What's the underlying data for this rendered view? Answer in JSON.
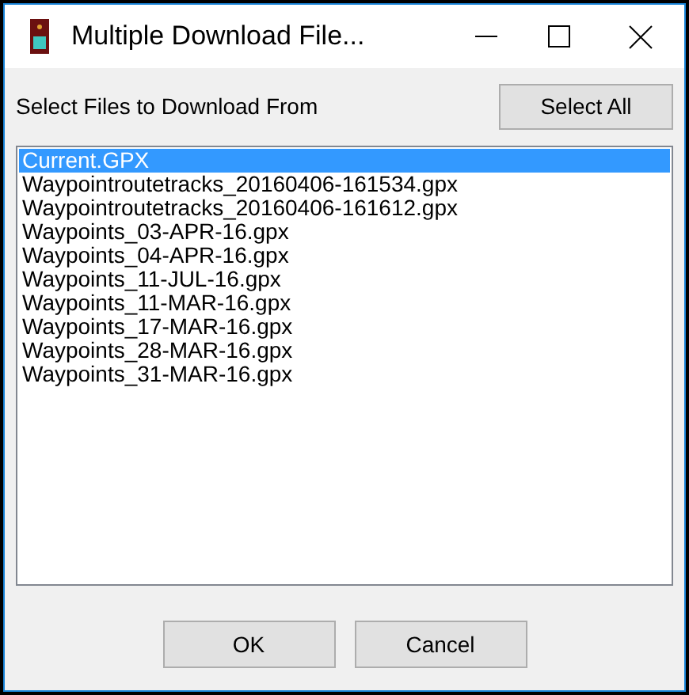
{
  "window": {
    "title": "Multiple Download File..."
  },
  "select_all_button": "Select All",
  "list_label": "Select Files to Download From",
  "files": [
    {
      "name": "Current.GPX",
      "selected": true
    },
    {
      "name": "Waypointroutetracks_20160406-161534.gpx",
      "selected": false
    },
    {
      "name": "Waypointroutetracks_20160406-161612.gpx",
      "selected": false
    },
    {
      "name": "Waypoints_03-APR-16.gpx",
      "selected": false
    },
    {
      "name": "Waypoints_04-APR-16.gpx",
      "selected": false
    },
    {
      "name": "Waypoints_11-JUL-16.gpx",
      "selected": false
    },
    {
      "name": "Waypoints_11-MAR-16.gpx",
      "selected": false
    },
    {
      "name": "Waypoints_17-MAR-16.gpx",
      "selected": false
    },
    {
      "name": "Waypoints_28-MAR-16.gpx",
      "selected": false
    },
    {
      "name": "Waypoints_31-MAR-16.gpx",
      "selected": false
    }
  ],
  "buttons": [
    "OK",
    "Cancel"
  ]
}
